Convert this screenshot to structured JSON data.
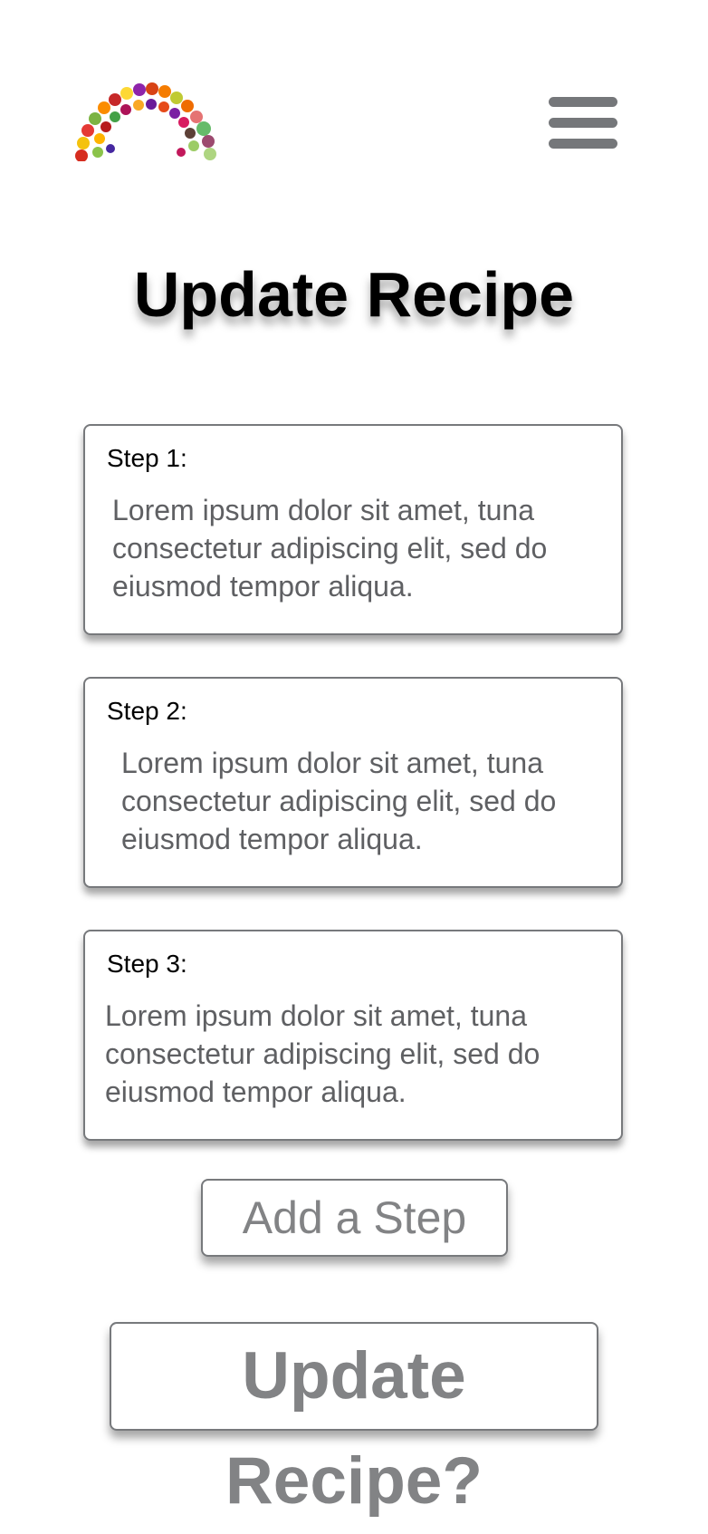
{
  "header": {
    "logo_icon": "fruit-vegetable-rainbow-logo",
    "menu_icon": "hamburger-menu-icon"
  },
  "page": {
    "title": "Update Recipe"
  },
  "steps": [
    {
      "label": "Step 1:",
      "text": "Lorem ipsum dolor sit amet, tuna consectetur adipiscing elit, sed do eiusmod tempor aliqua."
    },
    {
      "label": "Step 2:",
      "text": "Lorem ipsum dolor sit amet, tuna consectetur adipiscing elit, sed do eiusmod tempor aliqua."
    },
    {
      "label": "Step 3:",
      "text": "Lorem ipsum dolor sit amet, tuna consectetur adipiscing elit, sed do eiusmod tempor aliqua."
    }
  ],
  "actions": {
    "add_step_label": "Add a Step",
    "update_label": "Update Recipe?"
  },
  "colors": {
    "text_muted": "#5f6063",
    "border": "#77797c",
    "menu": "#75777a",
    "button_text": "#828385"
  }
}
